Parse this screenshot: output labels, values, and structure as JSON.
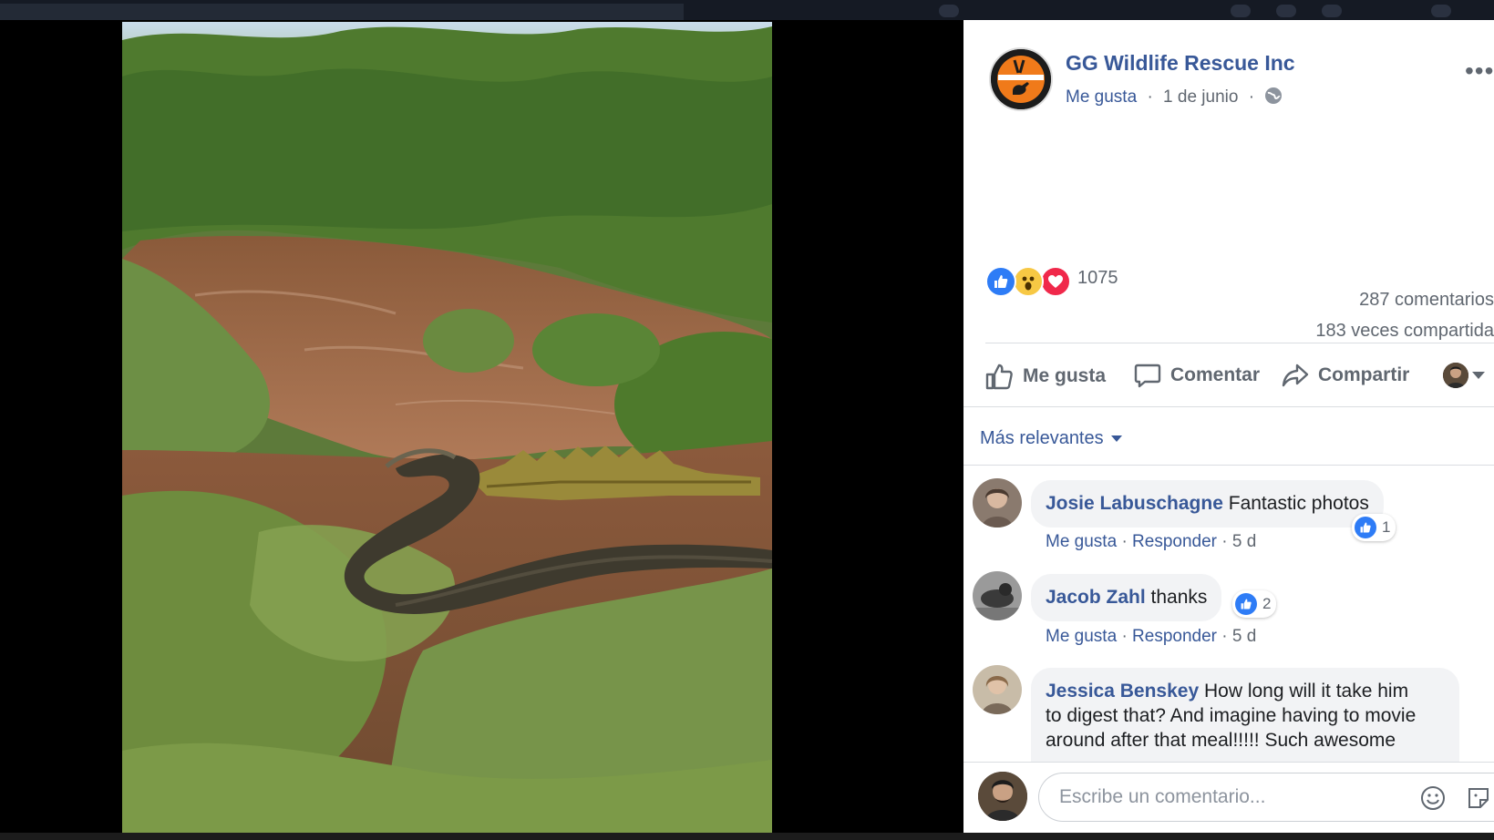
{
  "post": {
    "page_name": "GG Wildlife Rescue Inc",
    "like_label": "Me gusta",
    "separator": "·",
    "date": "1 de junio",
    "more_icon": "more-dots-icon",
    "audience_icon": "globe-icon"
  },
  "stats": {
    "reaction_icons": [
      "like-reaction-icon",
      "wow-reaction-icon",
      "love-reaction-icon"
    ],
    "reaction_count": "1075",
    "comments": "287 comentarios",
    "shares": "183 veces compartida"
  },
  "actions": {
    "like": "Me gusta",
    "comment": "Comentar",
    "share": "Compartir"
  },
  "sort": {
    "label": "Más relevantes"
  },
  "comments": [
    {
      "author": "Josie Labuschagne",
      "text": "Fantastic photos",
      "like_label": "Me gusta",
      "reply_label": "Responder",
      "age": "5 d",
      "likes": "1"
    },
    {
      "author": "Jacob Zahl",
      "text": "thanks",
      "like_label": "Me gusta",
      "reply_label": "Responder",
      "age": "5 d",
      "likes": "2"
    },
    {
      "author": "Jessica Benskey",
      "text_line1": "How long will it take him",
      "text_line2": "to digest that? And imagine having to movie",
      "text_line3": "around after that meal!!!!! Such awesome"
    }
  ],
  "composer": {
    "placeholder": "Escribe un comentario..."
  },
  "colors": {
    "link": "#385898",
    "muted": "#606770",
    "like_blue": "#2e7cf6",
    "love_red": "#f0284a",
    "wow_yellow": "#f7c844"
  }
}
